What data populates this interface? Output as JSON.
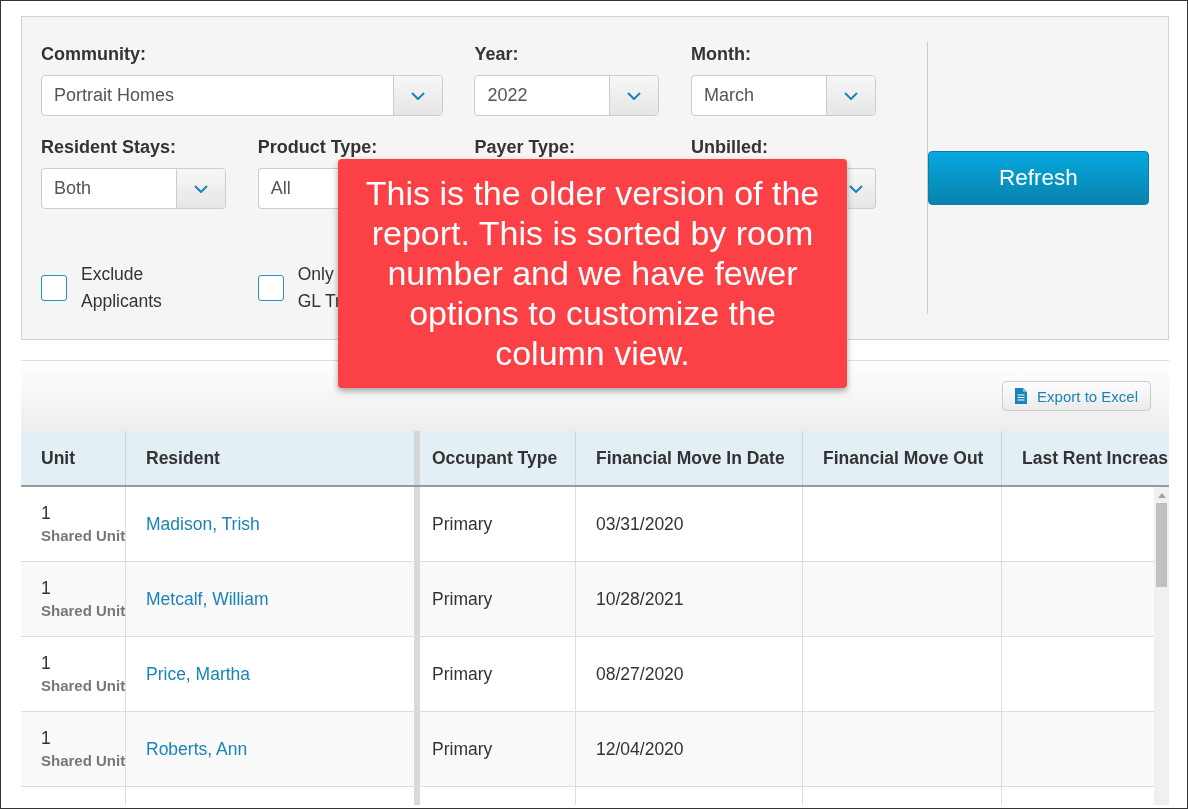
{
  "filters": [
    {
      "kind": "select_wide",
      "label": "Community:",
      "value": "Portrait Homes"
    },
    {
      "kind": "select",
      "label": "Year:",
      "value": "2022"
    },
    {
      "kind": "select",
      "label": "Month:",
      "value": "March"
    },
    {
      "kind": "select",
      "label": "Resident Stays:",
      "value": "Both"
    },
    {
      "kind": "select_cut",
      "label": "Product Type:",
      "value": "All"
    },
    {
      "kind": "label_only",
      "label": "Payer Type:"
    },
    {
      "kind": "toggle_only",
      "label": "Unbilled:"
    }
  ],
  "checkboxes": [
    {
      "label_lines": [
        "Exclude",
        "Applicants"
      ],
      "checked": false
    },
    {
      "label_lines": [
        "Only",
        "GL Tr"
      ],
      "checked": false
    }
  ],
  "refresh_button": "Refresh",
  "callout": {
    "text": "This is the older version of the report. This is sorted by room number and we have fewer options to customize the column view."
  },
  "export_button": "Export to Excel",
  "table": {
    "columns": [
      "Unit",
      "Resident",
      "Occupant Type",
      "Financial Move In Date",
      "Financial Move Out",
      "Last Rent Increas"
    ],
    "rows": [
      {
        "unit": "1",
        "unit_type": "Shared Unit",
        "resident": "Madison, Trish",
        "occupant_type": "Primary",
        "financial_move_in_date": "03/31/2020"
      },
      {
        "unit": "1",
        "unit_type": "Shared Unit",
        "resident": "Metcalf, William",
        "occupant_type": "Primary",
        "financial_move_in_date": "10/28/2021"
      },
      {
        "unit": "1",
        "unit_type": "Shared Unit",
        "resident": "Price, Martha",
        "occupant_type": "Primary",
        "financial_move_in_date": "08/27/2020"
      },
      {
        "unit": "1",
        "unit_type": "Shared Unit",
        "resident": "Roberts, Ann",
        "occupant_type": "Primary",
        "financial_move_in_date": "12/04/2020"
      }
    ]
  }
}
